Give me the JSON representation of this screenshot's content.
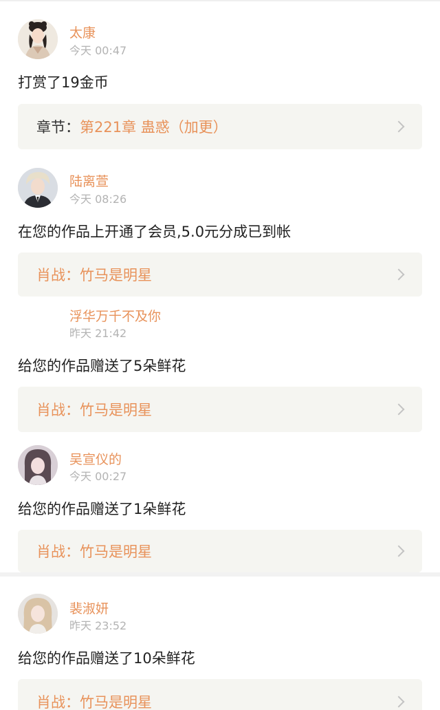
{
  "notifications": [
    {
      "username": "太康",
      "time": "今天 00:47",
      "action": "打赏了19金币",
      "card_prefix": "章节：",
      "card_link": "第221章 蛊惑（加更）",
      "avatar": "woman-hanfu-avatar"
    },
    {
      "username": "陆离萱",
      "time": "今天 08:26",
      "action": "在您的作品上开通了会员,5.0元分成已到帐",
      "card_prefix": "",
      "card_link": "肖战：竹马是明星",
      "avatar": "young-man-avatar"
    },
    {
      "username": "浮华万千不及你",
      "time": "昨天 21:42",
      "action": "给您的作品赠送了5朵鲜花",
      "card_prefix": "",
      "card_link": "肖战：竹马是明星",
      "avatar": ""
    },
    {
      "username": "吴宣仪的",
      "time": "今天 00:27",
      "action": "给您的作品赠送了1朵鲜花",
      "card_prefix": "",
      "card_link": "肖战：竹马是明星",
      "avatar": "girl-avatar"
    },
    {
      "username": "裴淑妍",
      "time": "昨天 23:52",
      "action": "给您的作品赠送了10朵鲜花",
      "card_prefix": "",
      "card_link": "肖战：竹马是明星",
      "avatar": "blonde-girl-avatar"
    }
  ],
  "colors": {
    "accent": "#e8925a",
    "card_bg": "#f5f5f1",
    "time_gray": "#b3b3b3"
  }
}
